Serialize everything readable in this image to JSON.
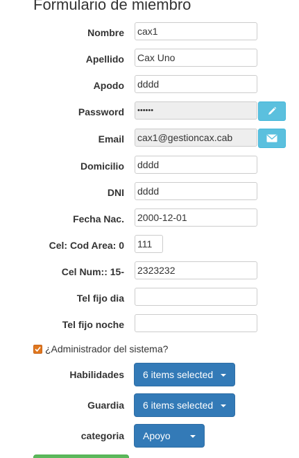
{
  "form": {
    "title": "Formulario de miembro",
    "fields": {
      "nombre": {
        "label": "Nombre",
        "value": "cax1"
      },
      "apellido": {
        "label": "Apellido",
        "value": "Cax Uno"
      },
      "apodo": {
        "label": "Apodo",
        "value": "dddd"
      },
      "password": {
        "label": "Password",
        "value": "••••••"
      },
      "email": {
        "label": "Email",
        "value": "cax1@gestioncax.cab"
      },
      "domicilio": {
        "label": "Domicilio",
        "value": "dddd"
      },
      "dni": {
        "label": "DNI",
        "value": "dddd"
      },
      "fecha_nac": {
        "label": "Fecha Nac.",
        "value": "2000-12-01"
      },
      "cel_cod_area": {
        "label": "Cel: Cod Area: 0",
        "value": "111"
      },
      "cel_num": {
        "label": "Cel Num:: 15-",
        "value": "2323232"
      },
      "tel_fijo_dia": {
        "label": "Tel fijo dia",
        "value": ""
      },
      "tel_fijo_noche": {
        "label": "Tel fijo noche",
        "value": ""
      }
    },
    "admin_checkbox": {
      "label": "¿Administrador del sistema?",
      "checked": true
    },
    "habilidades": {
      "label": "Habilidades",
      "selected": "6 items selected"
    },
    "guardia": {
      "label": "Guardia",
      "selected": "6 items selected"
    },
    "categoria": {
      "label": "categoria",
      "selected": "Apoyo"
    }
  },
  "colors": {
    "info_button": "#5bc0de",
    "primary_button": "#337ab7",
    "checkbox_accent": "#e0771e",
    "success_button": "#5cb85c",
    "readonly_bg": "#eeeeee"
  },
  "icons": {
    "password_button": "pencil-icon",
    "email_button": "envelope-icon",
    "checkbox": "check-icon",
    "select": "caret-down-icon"
  }
}
